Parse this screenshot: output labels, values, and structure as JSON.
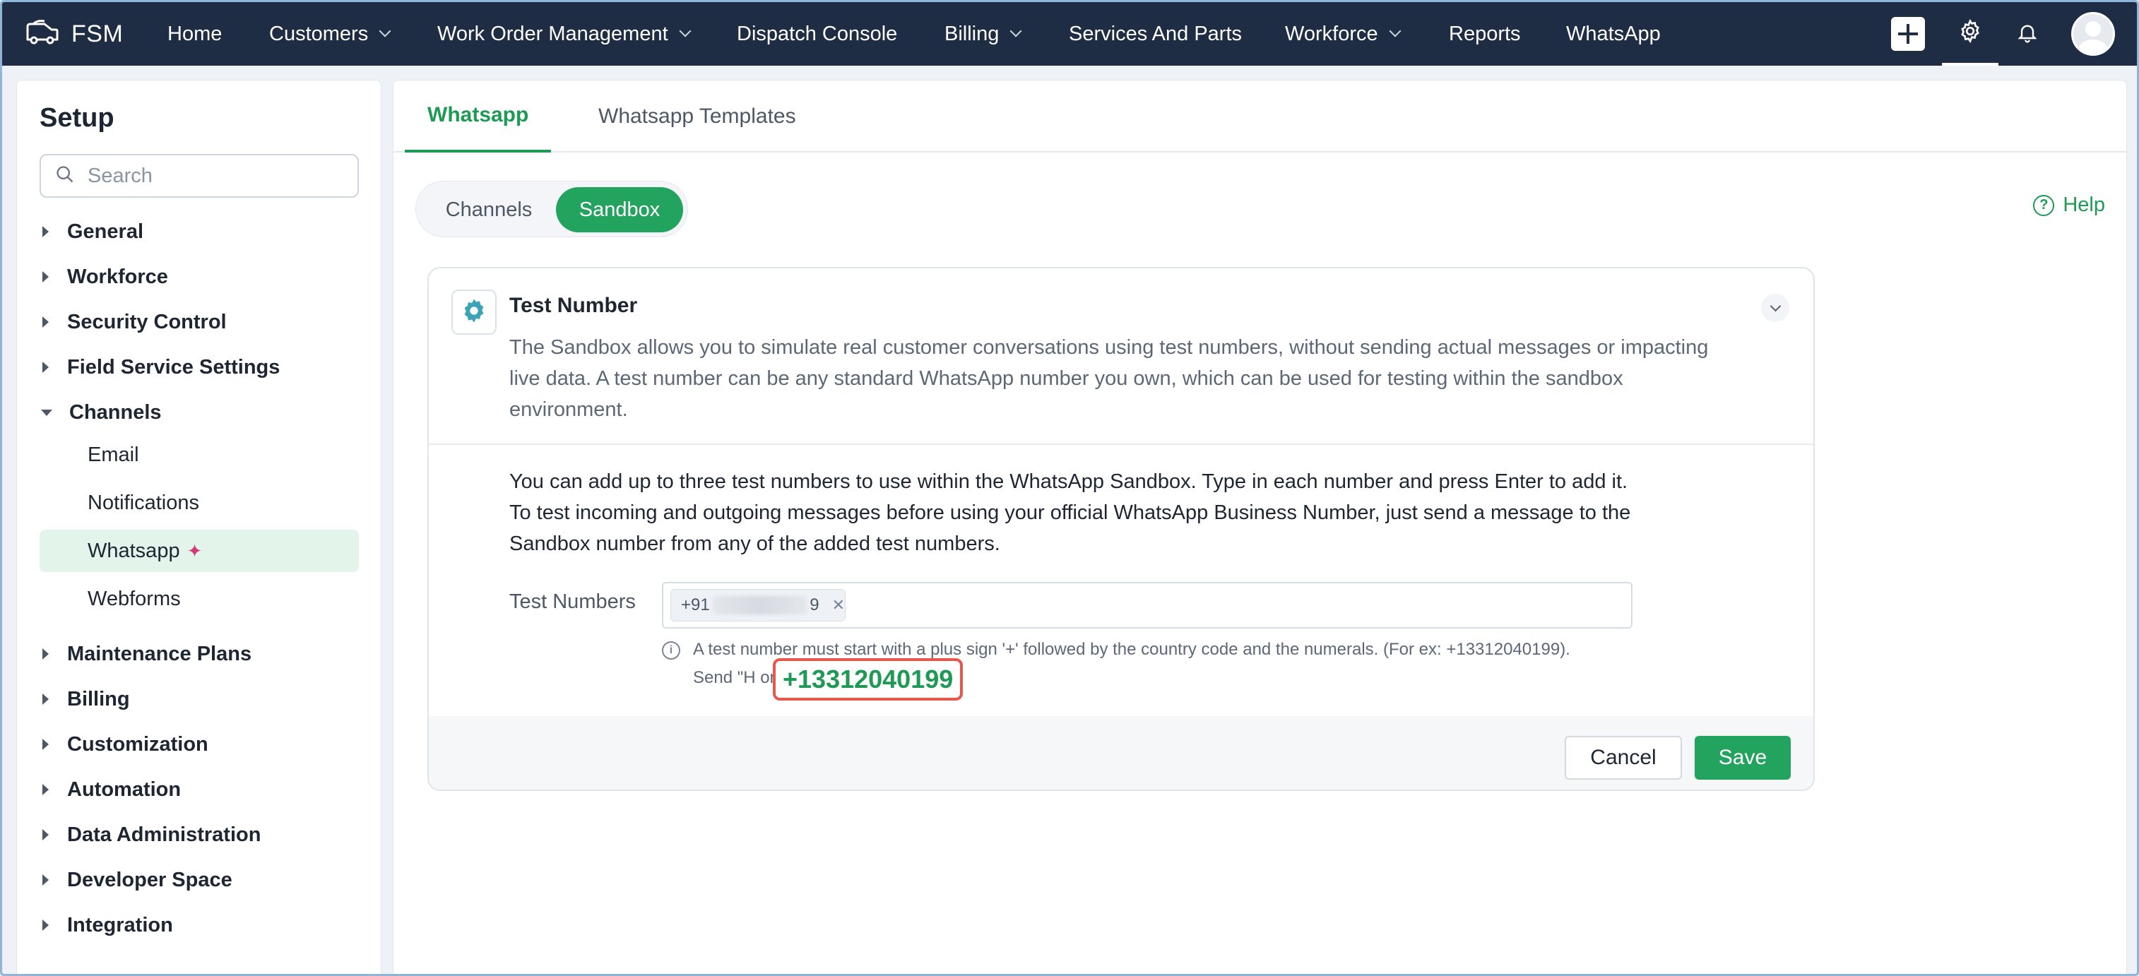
{
  "topbar": {
    "brand": "FSM",
    "nav": [
      {
        "label": "Home",
        "dropdown": false
      },
      {
        "label": "Customers",
        "dropdown": true
      },
      {
        "label": "Work Order Management",
        "dropdown": true
      },
      {
        "label": "Dispatch Console",
        "dropdown": false
      },
      {
        "label": "Billing",
        "dropdown": true
      },
      {
        "label": "Services And Parts",
        "dropdown": false
      },
      {
        "label": "Workforce",
        "dropdown": true
      },
      {
        "label": "Reports",
        "dropdown": false
      },
      {
        "label": "WhatsApp",
        "dropdown": false
      }
    ],
    "icons": [
      "plus-icon",
      "gear-icon",
      "bell-icon",
      "avatar"
    ]
  },
  "sidebar": {
    "title": "Setup",
    "search_placeholder": "Search",
    "sections": [
      {
        "label": "General",
        "expanded": false
      },
      {
        "label": "Workforce",
        "expanded": false
      },
      {
        "label": "Security Control",
        "expanded": false
      },
      {
        "label": "Field Service Settings",
        "expanded": false
      },
      {
        "label": "Channels",
        "expanded": true
      },
      {
        "label": "Maintenance Plans",
        "expanded": false
      },
      {
        "label": "Billing",
        "expanded": false
      },
      {
        "label": "Customization",
        "expanded": false
      },
      {
        "label": "Automation",
        "expanded": false
      },
      {
        "label": "Data Administration",
        "expanded": false
      },
      {
        "label": "Developer Space",
        "expanded": false
      },
      {
        "label": "Integration",
        "expanded": false
      }
    ],
    "channel_items": [
      {
        "label": "Email",
        "active": false
      },
      {
        "label": "Notifications",
        "active": false
      },
      {
        "label": "Whatsapp",
        "active": true
      },
      {
        "label": "Webforms",
        "active": false
      }
    ]
  },
  "main": {
    "tabs": [
      {
        "label": "Whatsapp",
        "active": true
      },
      {
        "label": "Whatsapp Templates",
        "active": false
      }
    ],
    "segments": [
      {
        "label": "Channels",
        "active": false
      },
      {
        "label": "Sandbox",
        "active": true
      }
    ],
    "help_label": "Help",
    "card": {
      "title": "Test Number",
      "description": "The Sandbox allows you to simulate real customer conversations using test numbers, without sending actual messages or impacting live data. A test number can be any standard WhatsApp number you own, which can be used for testing within the sandbox environment.",
      "info": "You can add up to three test numbers to use within the WhatsApp Sandbox. Type in each number and press Enter to add it. To test incoming and outgoing messages before using your official WhatsApp Business Number, just send a message to the Sandbox number from any of the added test numbers.",
      "field_label": "Test Numbers",
      "chip_prefix": "+91",
      "chip_suffix": "9",
      "hint_line1": "A test number must start with a plus sign '+' followed by the country code and the numerals. (For ex: +13312040199).",
      "hint_line2": "Send \"H                         onnect to the Sandbox.",
      "highlight_number": "+13312040199",
      "cancel_label": "Cancel",
      "save_label": "Save"
    }
  },
  "colors": {
    "topbar": "#1f2d44",
    "accent_green": "#22a35e",
    "highlight_border": "#e8574d"
  }
}
